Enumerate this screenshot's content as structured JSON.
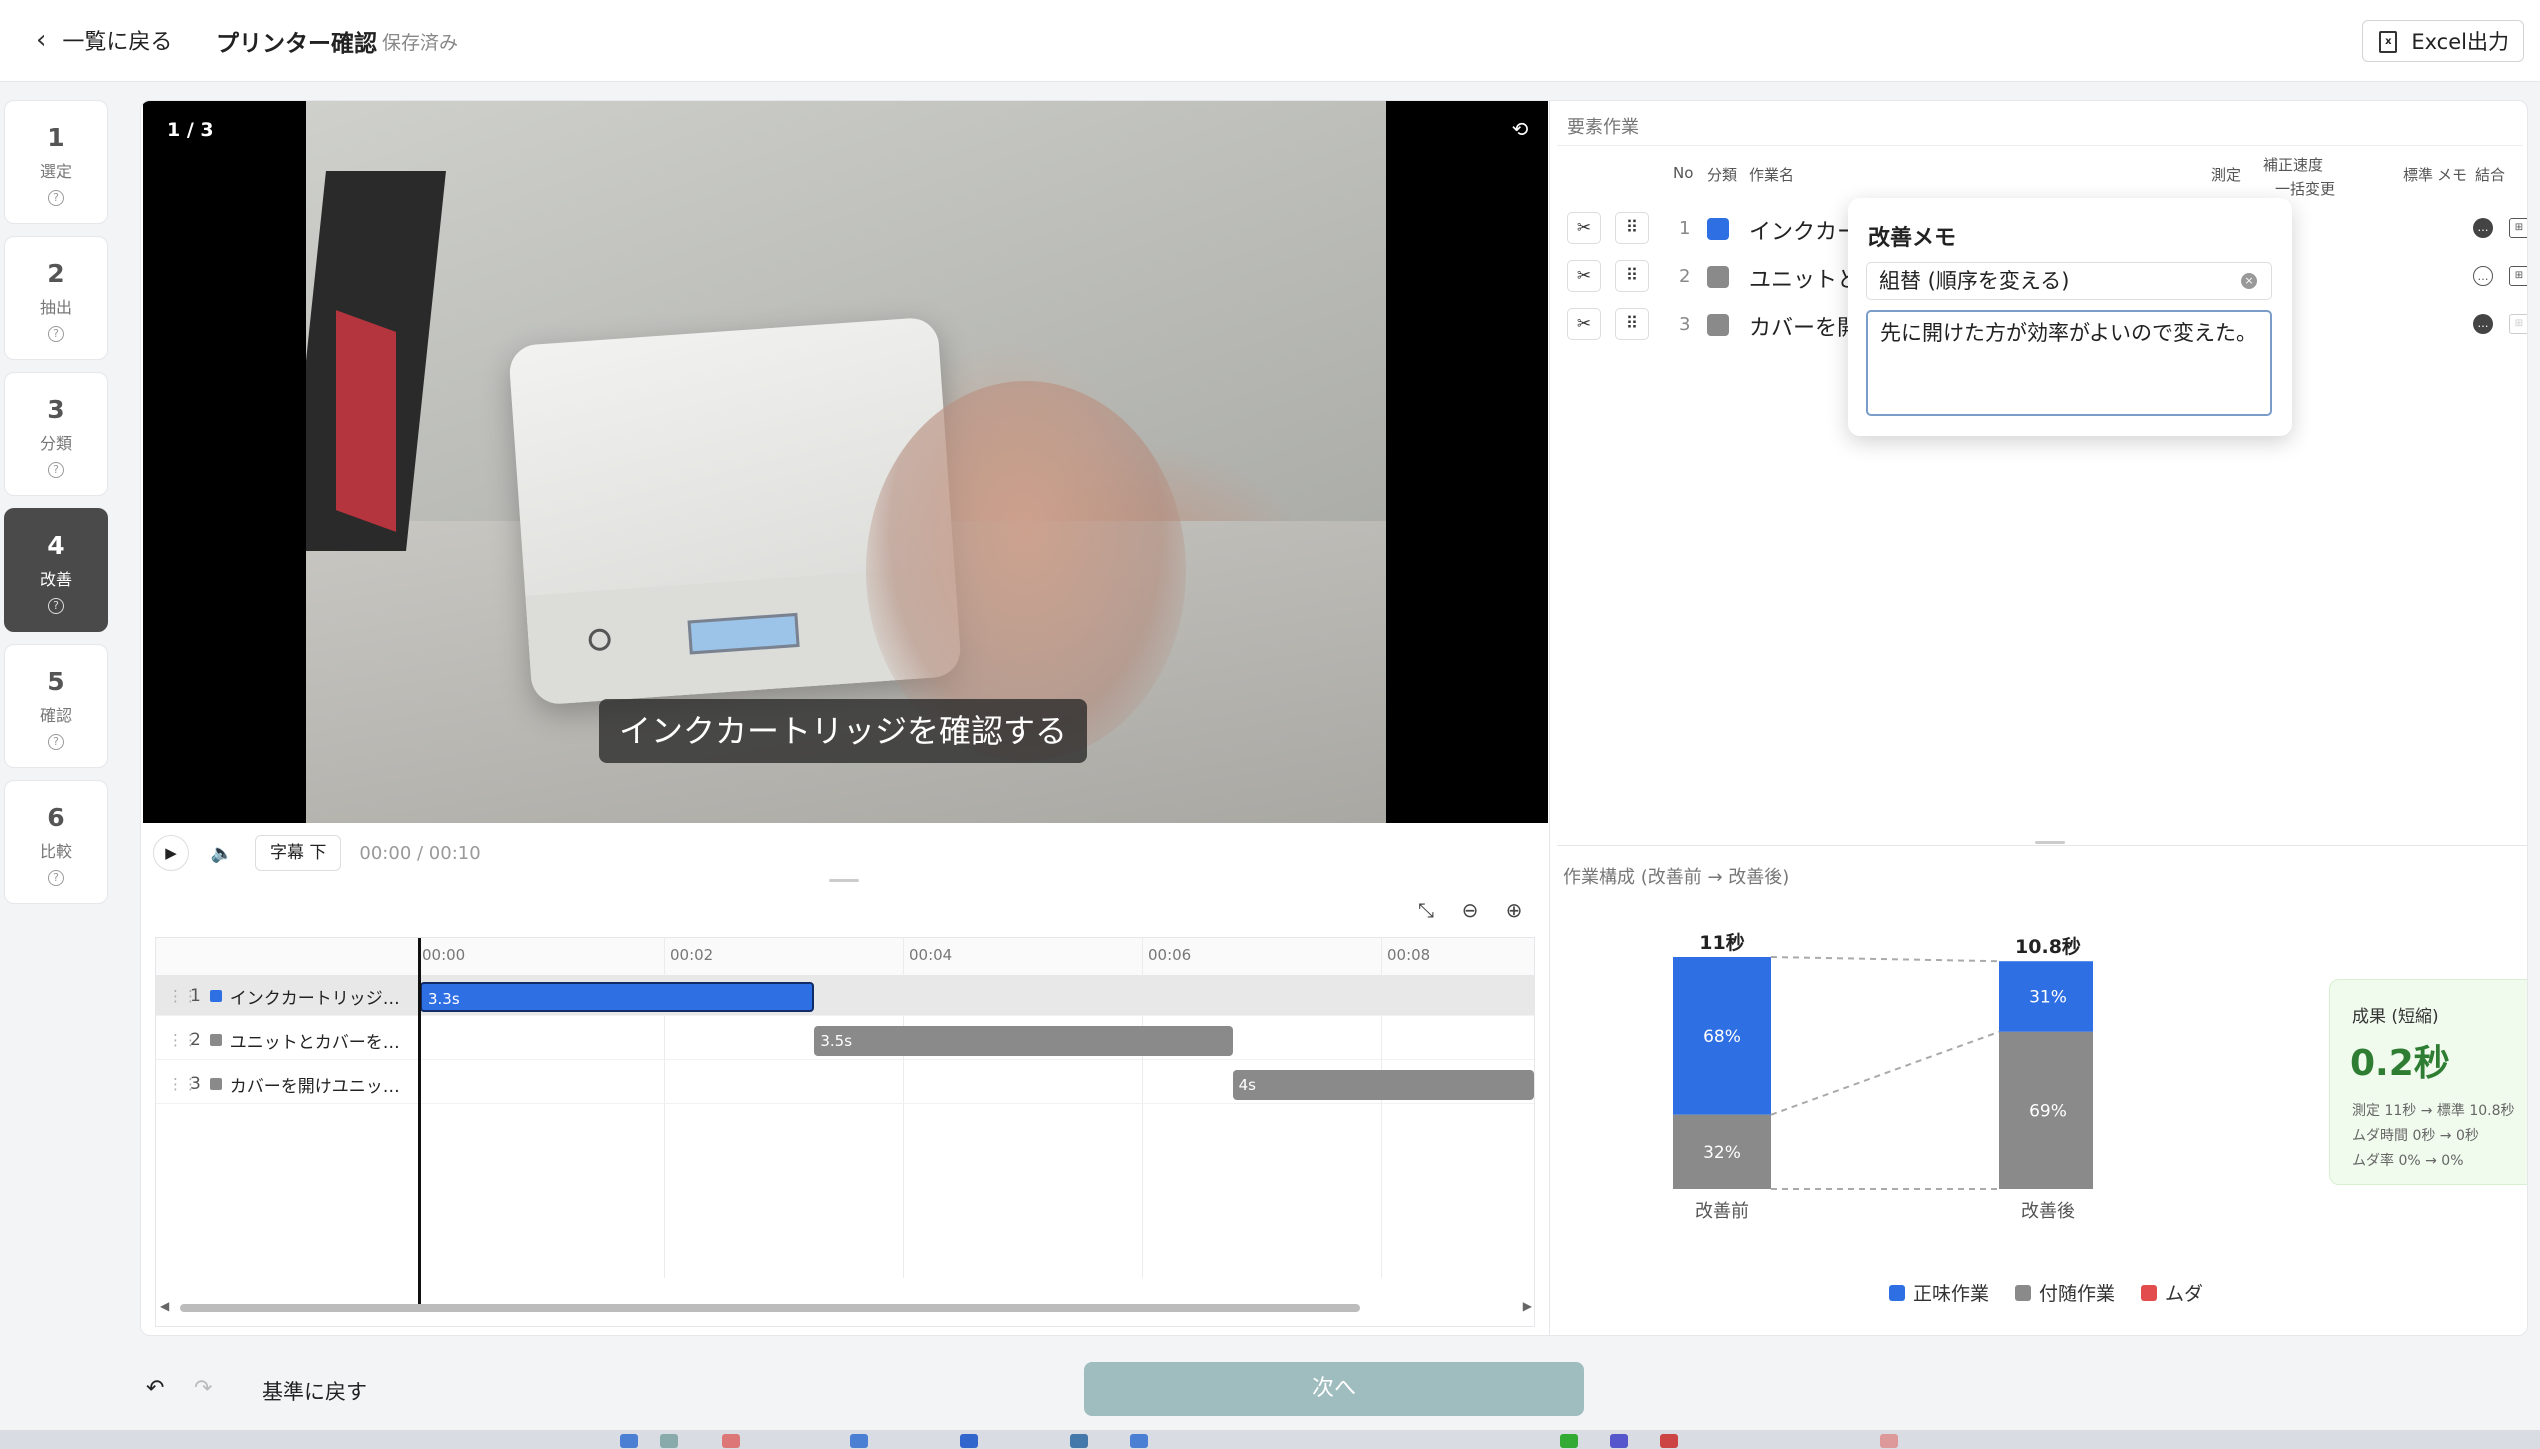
{
  "header": {
    "back_label": "一覧に戻る",
    "title": "プリンター確認",
    "saved_label": "保存済み",
    "excel_label": "Excel出力"
  },
  "steps": [
    {
      "num": "1",
      "label": "選定",
      "active": false
    },
    {
      "num": "2",
      "label": "抽出",
      "active": false
    },
    {
      "num": "3",
      "label": "分類",
      "active": false
    },
    {
      "num": "4",
      "label": "改善",
      "active": true
    },
    {
      "num": "5",
      "label": "確認",
      "active": false
    },
    {
      "num": "6",
      "label": "比較",
      "active": false
    }
  ],
  "video": {
    "counter": "1 / 3",
    "caption": "インクカートリッジを確認する",
    "subtitle_button": "字幕 下",
    "time": "00:00 / 00:10"
  },
  "timeline": {
    "ticks": [
      "00:00",
      "00:02",
      "00:04",
      "00:06",
      "00:08"
    ],
    "rows": [
      {
        "no": "1",
        "name": "インクカートリッジを確認する",
        "duration": "3.3s",
        "start": 0.0,
        "seconds": 3.3,
        "color": "#2f6fe4",
        "selected": true
      },
      {
        "no": "2",
        "name": "ユニットとカバーを閉じる",
        "duration": "3.5s",
        "start": 3.3,
        "seconds": 3.5,
        "color": "#8a8a8a",
        "selected": false
      },
      {
        "no": "3",
        "name": "カバーを開けユニットを持ち上げる",
        "duration": "4s",
        "start": 6.8,
        "seconds": 4.0,
        "color": "#8a8a8a",
        "selected": false
      }
    ]
  },
  "elements": {
    "section_title": "要素作業",
    "headers": {
      "no": "No",
      "category": "分類",
      "name": "作業名",
      "measure": "測定",
      "rate": "補正速度",
      "rate_sub": "一括変更",
      "standard": "標準",
      "memo": "メモ",
      "join": "結合"
    },
    "rows": [
      {
        "no": "1",
        "name": "インクカートリッジを確認する",
        "color": "#2f6fe4"
      },
      {
        "no": "2",
        "name": "ユニットとカバーを閉じる",
        "color": "#8a8a8a"
      },
      {
        "no": "3",
        "name": "カバーを開けユニットを持ち上げる",
        "color": "#8a8a8a"
      }
    ]
  },
  "memo_popover": {
    "title": "改善メモ",
    "selected": "組替 (順序を変える)",
    "text": "先に開けた方が効率がよいので変えた。"
  },
  "composition": {
    "section_title": "作業構成 (改善前 → 改善後)",
    "legend": [
      {
        "label": "正味作業",
        "color": "#2f6fe4"
      },
      {
        "label": "付随作業",
        "color": "#8a8a8a"
      },
      {
        "label": "ムダ",
        "color": "#e24c4c"
      }
    ]
  },
  "chart_data": {
    "type": "bar",
    "stacked": true,
    "categories": [
      "改善前",
      "改善後"
    ],
    "totals": [
      "11秒",
      "10.8秒"
    ],
    "total_values": [
      11,
      10.8
    ],
    "series": [
      {
        "name": "正味作業",
        "values": [
          68,
          31
        ],
        "labels": [
          "68%",
          "31%"
        ]
      },
      {
        "name": "付随作業",
        "values": [
          32,
          69
        ],
        "labels": [
          "32%",
          "69%"
        ]
      }
    ]
  },
  "result": {
    "title": "成果 (短縮)",
    "value": "0.2秒",
    "lines": [
      "測定 11秒 → 標準 10.8秒",
      "ムダ時間 0秒 → 0秒",
      "ムダ率 0% → 0%"
    ]
  },
  "footer": {
    "reset_label": "基準に戻す",
    "next_label": "次へ"
  }
}
